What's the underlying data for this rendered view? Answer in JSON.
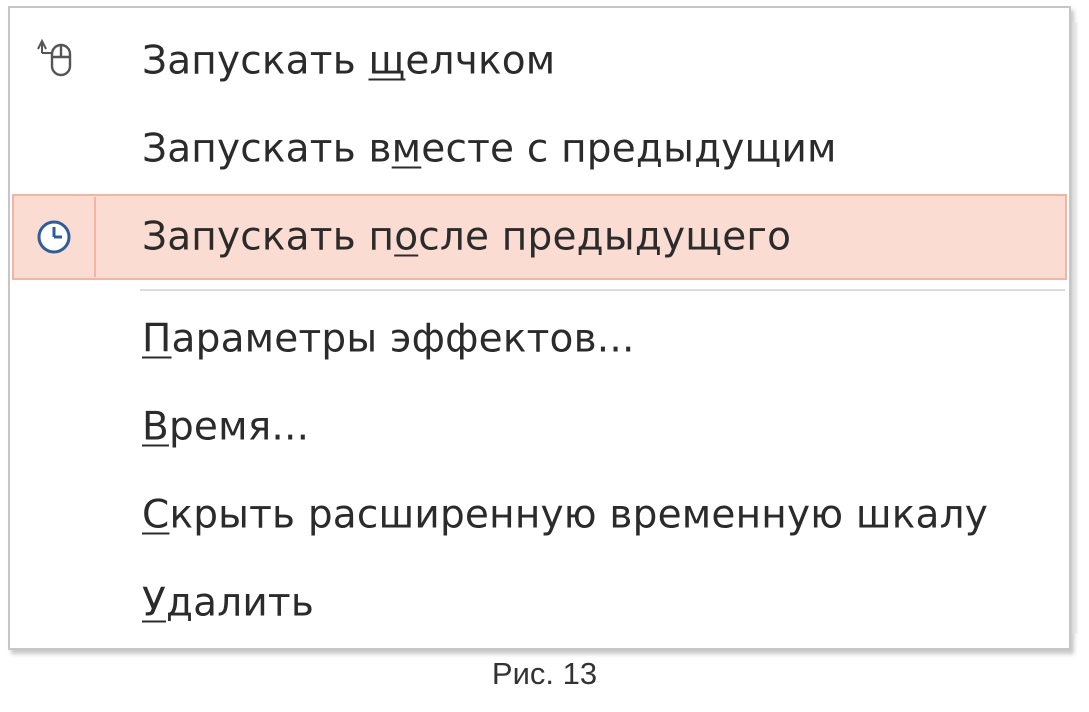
{
  "menu": {
    "items": [
      {
        "pre": "Запускать ",
        "accel": "щ",
        "post": "елчком",
        "icon": "mouse-click-icon"
      },
      {
        "pre": "Запускать в",
        "accel": "м",
        "post": "есте с предыдущим",
        "icon": ""
      },
      {
        "pre": "Запускать п",
        "accel": "о",
        "post": "сле предыдущего",
        "icon": "clock-icon",
        "highlighted": true
      },
      {
        "pre": "",
        "accel": "П",
        "post": "араметры эффектов...",
        "icon": ""
      },
      {
        "pre": "",
        "accel": "В",
        "post": "ремя...",
        "icon": ""
      },
      {
        "pre": "",
        "accel": "С",
        "post": "крыть расширенную временную шкалу",
        "icon": ""
      },
      {
        "pre": "",
        "accel": "У",
        "post": "далить",
        "icon": ""
      }
    ]
  },
  "caption": "Рис. 13",
  "colors": {
    "highlight_bg": "#fbdcd3",
    "highlight_border": "#f3b5a2",
    "clock_accent": "#2f5d9a"
  }
}
